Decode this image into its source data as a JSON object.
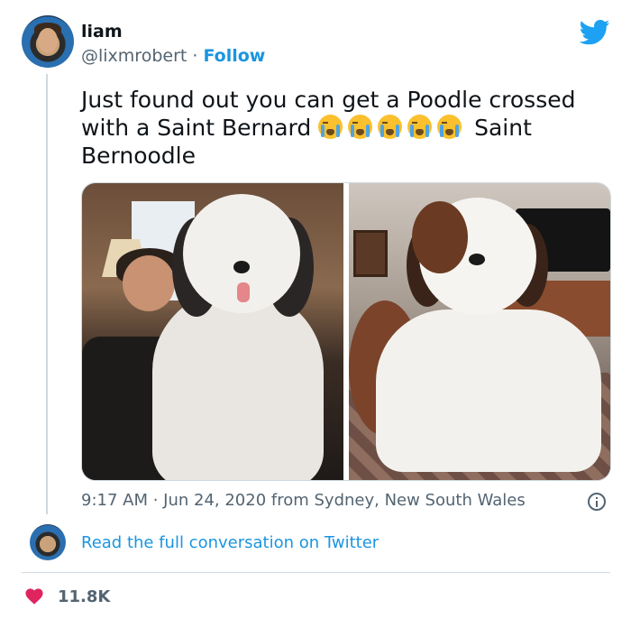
{
  "user": {
    "name": "liam",
    "handle": "@lixmrobert",
    "separator": " · ",
    "follow_label": "Follow"
  },
  "tweet": {
    "text_part1": "Just found out you can get a Poodle crossed with a Saint Bernard ",
    "emoji_name": "loudly-crying-face",
    "emoji_count": 5,
    "text_part2": " Saint Bernoodle",
    "timestamp": "9:17 AM · Jun 24, 2020 from Sydney, New South Wales"
  },
  "media": {
    "images": [
      {
        "name": "photo-woman-with-dog"
      },
      {
        "name": "photo-saint-bernoodle"
      }
    ]
  },
  "conversation": {
    "link_label": "Read the full conversation on Twitter"
  },
  "stats": {
    "likes": "11.8K"
  },
  "colors": {
    "link": "#1b95e0",
    "text": "#0f1419",
    "secondary": "#536471",
    "heart": "#e0245e",
    "twitter_blue": "#1da1f2"
  },
  "icons": [
    "twitter-bird-icon",
    "info-icon",
    "heart-icon",
    "loudly-crying-face-emoji"
  ]
}
